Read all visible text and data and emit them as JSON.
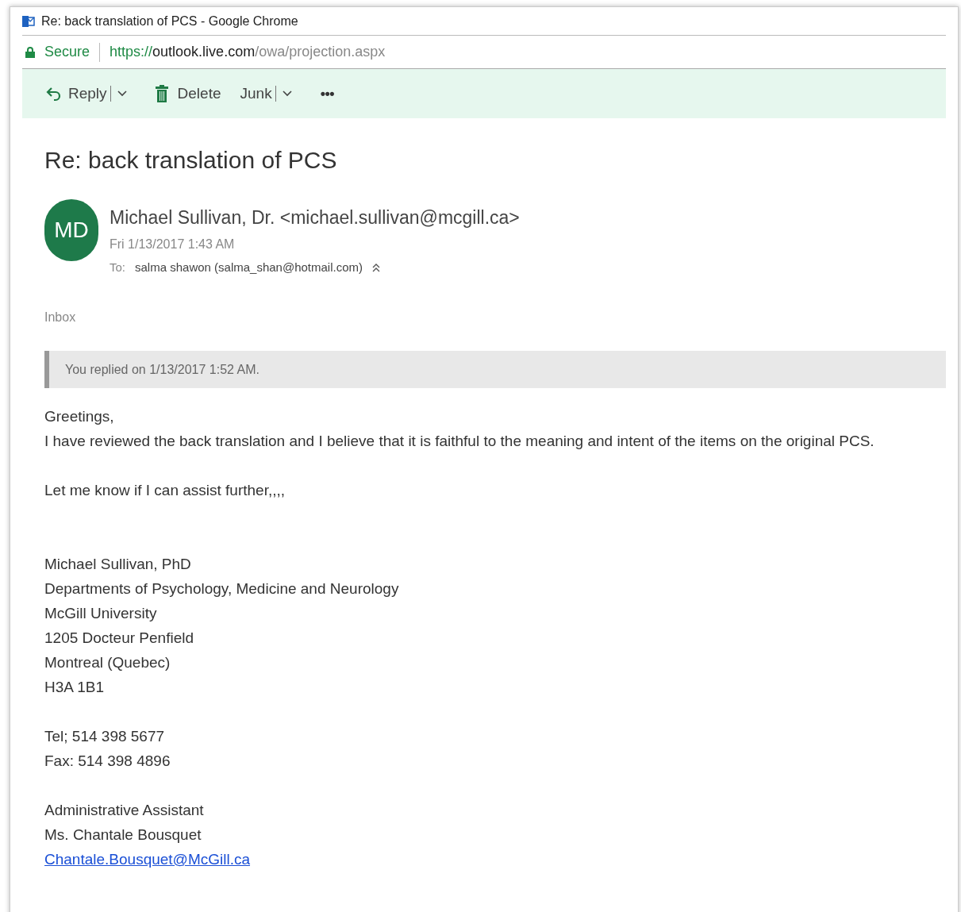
{
  "window": {
    "title": "Re: back translation of PCS - Google Chrome"
  },
  "address_bar": {
    "security": "Secure",
    "url_scheme": "https://",
    "url_host": "outlook.live.com",
    "url_path": "/owa/projection.aspx"
  },
  "toolbar": [
    {
      "kind": "reply",
      "label": "Reply"
    },
    {
      "kind": "delete",
      "label": "Delete"
    },
    {
      "kind": "junk",
      "label": "Junk"
    },
    {
      "kind": "more",
      "label": "•••"
    }
  ],
  "message": {
    "subject": "Re: back translation of PCS",
    "avatar_initials": "MD",
    "sender": "Michael Sullivan, Dr. <michael.sullivan@mcgill.ca>",
    "date": "Fri 1/13/2017 1:43 AM",
    "to_label": "To:",
    "to": "salma shawon (salma_shan@hotmail.com)",
    "folder": "Inbox",
    "reply_notice": "You replied on 1/13/2017 1:52 AM.",
    "body": [
      {
        "kind": "text",
        "text": "Greetings,"
      },
      {
        "kind": "text",
        "text": "I have reviewed the back translation and I believe that it is faithful to the meaning and intent of the items on the original PCS."
      },
      {
        "kind": "gap"
      },
      {
        "kind": "text",
        "text": "Let me know if I can assist further,,,,"
      },
      {
        "kind": "gap"
      },
      {
        "kind": "gap"
      },
      {
        "kind": "text",
        "text": "Michael Sullivan, PhD"
      },
      {
        "kind": "text",
        "text": "Departments of Psychology, Medicine and Neurology"
      },
      {
        "kind": "text",
        "text": "McGill University"
      },
      {
        "kind": "text",
        "text": "1205 Docteur Penfield"
      },
      {
        "kind": "text",
        "text": "Montreal (Quebec)"
      },
      {
        "kind": "text",
        "text": "H3A 1B1"
      },
      {
        "kind": "gap"
      },
      {
        "kind": "text",
        "text": "Tel; 514 398 5677"
      },
      {
        "kind": "text",
        "text": "Fax: 514 398 4896"
      },
      {
        "kind": "gap"
      },
      {
        "kind": "text",
        "text": "Administrative Assistant"
      },
      {
        "kind": "text",
        "text": "Ms. Chantale Bousquet"
      },
      {
        "kind": "link",
        "text": "Chantale.Bousquet@McGill.ca"
      }
    ]
  }
}
